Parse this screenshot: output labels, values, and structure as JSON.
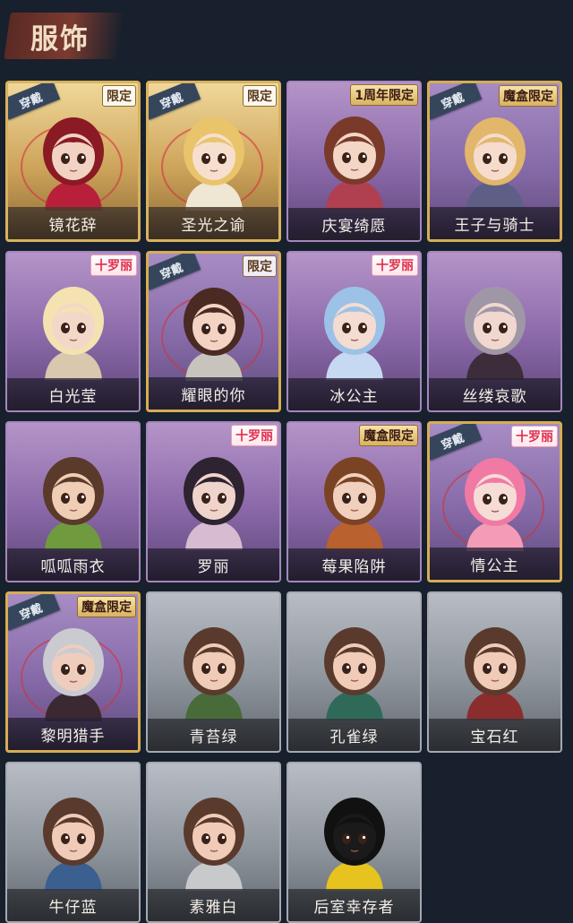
{
  "header": {
    "title": "服饰"
  },
  "owned_label": "穿戴",
  "cards": [
    {
      "name": "镜花辞",
      "style": "gold",
      "owned": true,
      "tag": "限定",
      "tag_style": "plain",
      "hair": "#8a1a24",
      "skin": "#f2d2c2",
      "cloth": "#b8203a",
      "ring": true
    },
    {
      "name": "圣光之谕",
      "style": "gold",
      "owned": true,
      "tag": "限定",
      "tag_style": "plain",
      "hair": "#e9c46a",
      "skin": "#f7dfcf",
      "cloth": "#f0e6d4",
      "ring": true
    },
    {
      "name": "庆宴绮愿",
      "style": "purple",
      "owned": false,
      "tag": "1周年限定",
      "tag_style": "gold",
      "hair": "#7a3a2a",
      "skin": "#f3d6c5",
      "cloth": "#b04050",
      "ring": false
    },
    {
      "name": "王子与骑士",
      "style": "gold-owned",
      "owned": true,
      "tag": "魔盒限定",
      "tag_style": "gold",
      "hair": "#e2b66b",
      "skin": "#f5dccc",
      "cloth": "#5d5f86",
      "ring": false
    },
    {
      "name": "白光莹",
      "style": "purple",
      "owned": false,
      "tag": "十罗丽",
      "tag_style": "pink",
      "hair": "#f4e3b0",
      "skin": "#f2d8c8",
      "cloth": "#d9c7ae",
      "ring": false
    },
    {
      "name": "耀眼的你",
      "style": "gold-owned",
      "owned": true,
      "tag": "限定",
      "tag_style": "plain",
      "hair": "#4a2a22",
      "skin": "#f3d4c4",
      "cloth": "#c9c3bd",
      "ring": true
    },
    {
      "name": "冰公主",
      "style": "purple",
      "owned": false,
      "tag": "十罗丽",
      "tag_style": "pink",
      "hair": "#9cc2e7",
      "skin": "#f4dcd2",
      "cloth": "#c7d9f2",
      "ring": false
    },
    {
      "name": "丝缕哀歌",
      "style": "purple",
      "owned": false,
      "tag": "",
      "tag_style": "none",
      "hair": "#9f97a6",
      "skin": "#f0d7d0",
      "cloth": "#3d2c3a",
      "ring": false
    },
    {
      "name": "呱呱雨衣",
      "style": "purple",
      "owned": false,
      "tag": "",
      "tag_style": "none",
      "hair": "#5a3a2a",
      "skin": "#f0cdb5",
      "cloth": "#6f9b3e",
      "ring": false
    },
    {
      "name": "罗丽",
      "style": "purple",
      "owned": false,
      "tag": "十罗丽",
      "tag_style": "pink",
      "hair": "#2e2330",
      "skin": "#eed4cb",
      "cloth": "#d7bbd1",
      "ring": false
    },
    {
      "name": "莓果陷阱",
      "style": "purple",
      "owned": false,
      "tag": "魔盒限定",
      "tag_style": "gold",
      "hair": "#7a4324",
      "skin": "#f1d0bd",
      "cloth": "#b9612f",
      "ring": false
    },
    {
      "name": "情公主",
      "style": "gold-owned",
      "owned": true,
      "tag": "十罗丽",
      "tag_style": "pink",
      "hair": "#f07aa4",
      "skin": "#f6dcd6",
      "cloth": "#f49cb7",
      "ring": true
    },
    {
      "name": "黎明猎手",
      "style": "gold-owned",
      "owned": true,
      "tag": "魔盒限定",
      "tag_style": "gold",
      "hair": "#c9cbd1",
      "skin": "#efcdbc",
      "cloth": "#3a2930",
      "ring": true
    },
    {
      "name": "青苔绿",
      "style": "grey",
      "owned": false,
      "tag": "",
      "tag_style": "none",
      "hair": "#5a3a2c",
      "skin": "#efcbb8",
      "cloth": "#496b3a",
      "ring": false
    },
    {
      "name": "孔雀绿",
      "style": "grey",
      "owned": false,
      "tag": "",
      "tag_style": "none",
      "hair": "#5a3a2c",
      "skin": "#efcbb8",
      "cloth": "#2f6a58",
      "ring": false
    },
    {
      "name": "宝石红",
      "style": "grey",
      "owned": false,
      "tag": "",
      "tag_style": "none",
      "hair": "#5a3a2c",
      "skin": "#efcbb8",
      "cloth": "#8c2d2d",
      "ring": false
    },
    {
      "name": "牛仔蓝",
      "style": "grey",
      "owned": false,
      "tag": "",
      "tag_style": "none",
      "hair": "#5a3a2c",
      "skin": "#efcbb8",
      "cloth": "#3b5f8e",
      "ring": false
    },
    {
      "name": "素雅白",
      "style": "grey",
      "owned": false,
      "tag": "",
      "tag_style": "none",
      "hair": "#5a3a2c",
      "skin": "#efcbb8",
      "cloth": "#c8c9cb",
      "ring": false
    },
    {
      "name": "后室幸存者",
      "style": "grey",
      "owned": false,
      "tag": "",
      "tag_style": "none",
      "hair": "#111111",
      "skin": "#1a1a1a",
      "cloth": "#e6c31f",
      "ring": false
    }
  ]
}
